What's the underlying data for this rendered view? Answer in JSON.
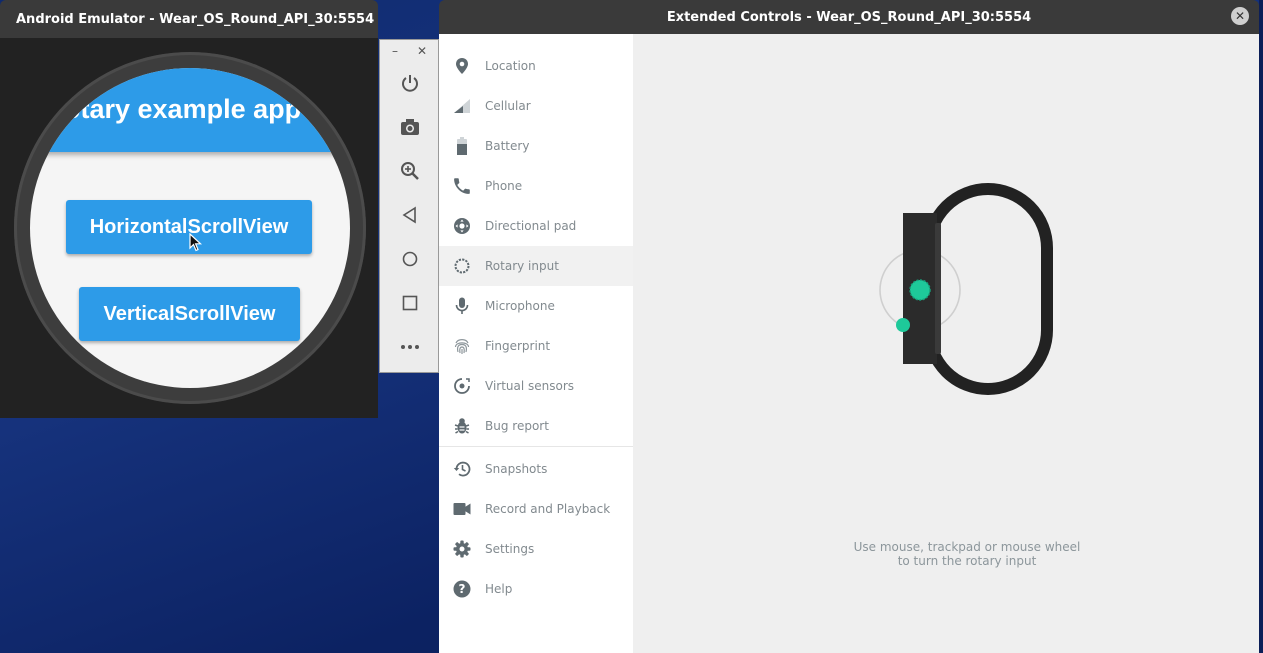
{
  "emulator": {
    "title": "Android Emulator - Wear_OS_Round_API_30:5554",
    "app": {
      "title": "otary example app",
      "buttons": [
        "HorizontalScrollView",
        "VerticalScrollView"
      ]
    },
    "toolbar": {
      "window_controls": [
        "–",
        "✕"
      ],
      "buttons": [
        "power-icon",
        "camera-icon",
        "zoom-in-icon",
        "back-icon",
        "home-icon",
        "overview-icon",
        "more-icon"
      ]
    }
  },
  "extended_controls": {
    "title": "Extended Controls - Wear_OS_Round_API_30:5554",
    "close_glyph": "✕",
    "nav": [
      {
        "label": "Location",
        "icon": "location-pin-icon"
      },
      {
        "label": "Cellular",
        "icon": "signal-icon"
      },
      {
        "label": "Battery",
        "icon": "battery-icon"
      },
      {
        "label": "Phone",
        "icon": "phone-icon"
      },
      {
        "label": "Directional pad",
        "icon": "dpad-icon"
      },
      {
        "label": "Rotary input",
        "icon": "rotary-icon",
        "active": true
      },
      {
        "label": "Microphone",
        "icon": "microphone-icon"
      },
      {
        "label": "Fingerprint",
        "icon": "fingerprint-icon"
      },
      {
        "label": "Virtual sensors",
        "icon": "sensors-icon"
      },
      {
        "label": "Bug report",
        "icon": "bug-icon"
      },
      {
        "label": "Snapshots",
        "icon": "history-icon"
      },
      {
        "label": "Record and Playback",
        "icon": "video-icon"
      },
      {
        "label": "Settings",
        "icon": "gear-icon"
      },
      {
        "label": "Help",
        "icon": "help-icon"
      }
    ],
    "hint_line1": "Use mouse, trackpad or mouse wheel",
    "hint_line2": "to turn the rotary input",
    "accent_color": "#1ec99a"
  }
}
